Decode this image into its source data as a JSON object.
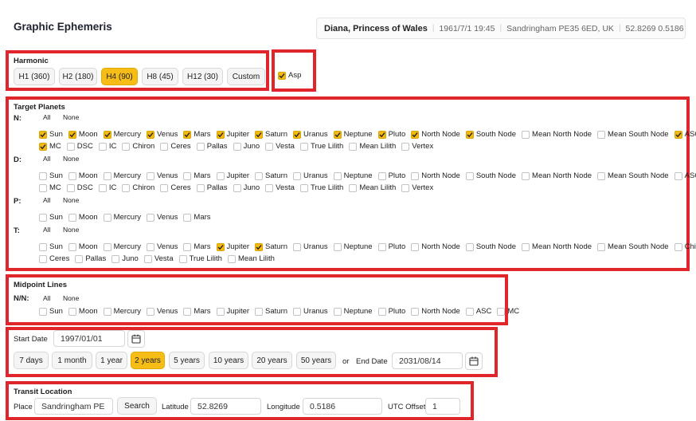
{
  "page_title": "Graphic Ephemeris",
  "chart_info": {
    "name": "Diana, Princess of Wales",
    "datetime": "1961/7/1 19:45",
    "place": "Sandringham PE35 6ED, UK",
    "coords": "52.8269 0.5186"
  },
  "harmonic": {
    "label": "Harmonic",
    "options": [
      "H1 (360)",
      "H2 (180)",
      "H4 (90)",
      "H8 (45)",
      "H12 (30)",
      "Custom"
    ],
    "selected": "H4 (90)"
  },
  "asp": {
    "label": "Asp",
    "checked": true
  },
  "target_planets": {
    "label": "Target Planets",
    "all_label": "All",
    "none_label": "None",
    "rows": [
      {
        "label": "N:",
        "lines": [
          [
            {
              "name": "Sun",
              "checked": true
            },
            {
              "name": "Moon",
              "checked": true
            },
            {
              "name": "Mercury",
              "checked": true
            },
            {
              "name": "Venus",
              "checked": true
            },
            {
              "name": "Mars",
              "checked": true
            },
            {
              "name": "Jupiter",
              "checked": true
            },
            {
              "name": "Saturn",
              "checked": true
            },
            {
              "name": "Uranus",
              "checked": true
            },
            {
              "name": "Neptune",
              "checked": true
            },
            {
              "name": "Pluto",
              "checked": true
            },
            {
              "name": "North Node",
              "checked": true
            },
            {
              "name": "South Node",
              "checked": true
            },
            {
              "name": "Mean North Node",
              "checked": false
            },
            {
              "name": "Mean South Node",
              "checked": false
            },
            {
              "name": "ASC",
              "checked": true
            }
          ],
          [
            {
              "name": "MC",
              "checked": true
            },
            {
              "name": "DSC",
              "checked": false
            },
            {
              "name": "IC",
              "checked": false
            },
            {
              "name": "Chiron",
              "checked": false
            },
            {
              "name": "Ceres",
              "checked": false
            },
            {
              "name": "Pallas",
              "checked": false
            },
            {
              "name": "Juno",
              "checked": false
            },
            {
              "name": "Vesta",
              "checked": false
            },
            {
              "name": "True Lilith",
              "checked": false
            },
            {
              "name": "Mean Lilith",
              "checked": false
            },
            {
              "name": "Vertex",
              "checked": false
            }
          ]
        ]
      },
      {
        "label": "D:",
        "lines": [
          [
            {
              "name": "Sun",
              "checked": false
            },
            {
              "name": "Moon",
              "checked": false
            },
            {
              "name": "Mercury",
              "checked": false
            },
            {
              "name": "Venus",
              "checked": false
            },
            {
              "name": "Mars",
              "checked": false
            },
            {
              "name": "Jupiter",
              "checked": false
            },
            {
              "name": "Saturn",
              "checked": false
            },
            {
              "name": "Uranus",
              "checked": false
            },
            {
              "name": "Neptune",
              "checked": false
            },
            {
              "name": "Pluto",
              "checked": false
            },
            {
              "name": "North Node",
              "checked": false
            },
            {
              "name": "South Node",
              "checked": false
            },
            {
              "name": "Mean North Node",
              "checked": false
            },
            {
              "name": "Mean South Node",
              "checked": false
            },
            {
              "name": "ASC",
              "checked": false
            }
          ],
          [
            {
              "name": "MC",
              "checked": false
            },
            {
              "name": "DSC",
              "checked": false
            },
            {
              "name": "IC",
              "checked": false
            },
            {
              "name": "Chiron",
              "checked": false
            },
            {
              "name": "Ceres",
              "checked": false
            },
            {
              "name": "Pallas",
              "checked": false
            },
            {
              "name": "Juno",
              "checked": false
            },
            {
              "name": "Vesta",
              "checked": false
            },
            {
              "name": "True Lilith",
              "checked": false
            },
            {
              "name": "Mean Lilith",
              "checked": false
            },
            {
              "name": "Vertex",
              "checked": false
            }
          ]
        ]
      },
      {
        "label": "P:",
        "lines": [
          [
            {
              "name": "Sun",
              "checked": false
            },
            {
              "name": "Moon",
              "checked": false
            },
            {
              "name": "Mercury",
              "checked": false
            },
            {
              "name": "Venus",
              "checked": false
            },
            {
              "name": "Mars",
              "checked": false
            }
          ]
        ]
      },
      {
        "label": "T:",
        "lines": [
          [
            {
              "name": "Sun",
              "checked": false
            },
            {
              "name": "Moon",
              "checked": false
            },
            {
              "name": "Mercury",
              "checked": false
            },
            {
              "name": "Venus",
              "checked": false
            },
            {
              "name": "Mars",
              "checked": false
            },
            {
              "name": "Jupiter",
              "checked": true
            },
            {
              "name": "Saturn",
              "checked": true
            },
            {
              "name": "Uranus",
              "checked": false
            },
            {
              "name": "Neptune",
              "checked": false
            },
            {
              "name": "Pluto",
              "checked": false
            },
            {
              "name": "North Node",
              "checked": false
            },
            {
              "name": "South Node",
              "checked": false
            },
            {
              "name": "Mean North Node",
              "checked": false
            },
            {
              "name": "Mean South Node",
              "checked": false
            },
            {
              "name": "Chiron",
              "checked": false
            }
          ],
          [
            {
              "name": "Ceres",
              "checked": false
            },
            {
              "name": "Pallas",
              "checked": false
            },
            {
              "name": "Juno",
              "checked": false
            },
            {
              "name": "Vesta",
              "checked": false
            },
            {
              "name": "True Lilith",
              "checked": false
            },
            {
              "name": "Mean Lilith",
              "checked": false
            }
          ]
        ]
      }
    ]
  },
  "midpoint_lines": {
    "label": "Midpoint Lines",
    "row_label": "N/N:",
    "all_label": "All",
    "none_label": "None",
    "items": [
      {
        "name": "Sun",
        "checked": false
      },
      {
        "name": "Moon",
        "checked": false
      },
      {
        "name": "Mercury",
        "checked": false
      },
      {
        "name": "Venus",
        "checked": false
      },
      {
        "name": "Mars",
        "checked": false
      },
      {
        "name": "Jupiter",
        "checked": false
      },
      {
        "name": "Saturn",
        "checked": false
      },
      {
        "name": "Uranus",
        "checked": false
      },
      {
        "name": "Neptune",
        "checked": false
      },
      {
        "name": "Pluto",
        "checked": false
      },
      {
        "name": "North Node",
        "checked": false
      },
      {
        "name": "ASC",
        "checked": false
      },
      {
        "name": "MC",
        "checked": false
      }
    ]
  },
  "dates": {
    "start_label": "Start Date",
    "start_value": "1997/01/01",
    "ranges": [
      "7 days",
      "1 month",
      "1 year",
      "2 years",
      "5 years",
      "10 years",
      "20 years",
      "50 years"
    ],
    "selected_range": "2 years",
    "or_label": "or",
    "end_label": "End Date",
    "end_value": "2031/08/14"
  },
  "transit_location": {
    "label": "Transit Location",
    "place_label": "Place",
    "place_value": "Sandringham PE",
    "search_label": "Search",
    "latitude_label": "Latitude",
    "latitude_value": "52.8269",
    "longitude_label": "Longitude",
    "longitude_value": "0.5186",
    "utc_label": "UTC Offset",
    "utc_value": "1"
  },
  "colors": {
    "accent": "#f6bd16",
    "highlight_box": "#e0252b"
  }
}
